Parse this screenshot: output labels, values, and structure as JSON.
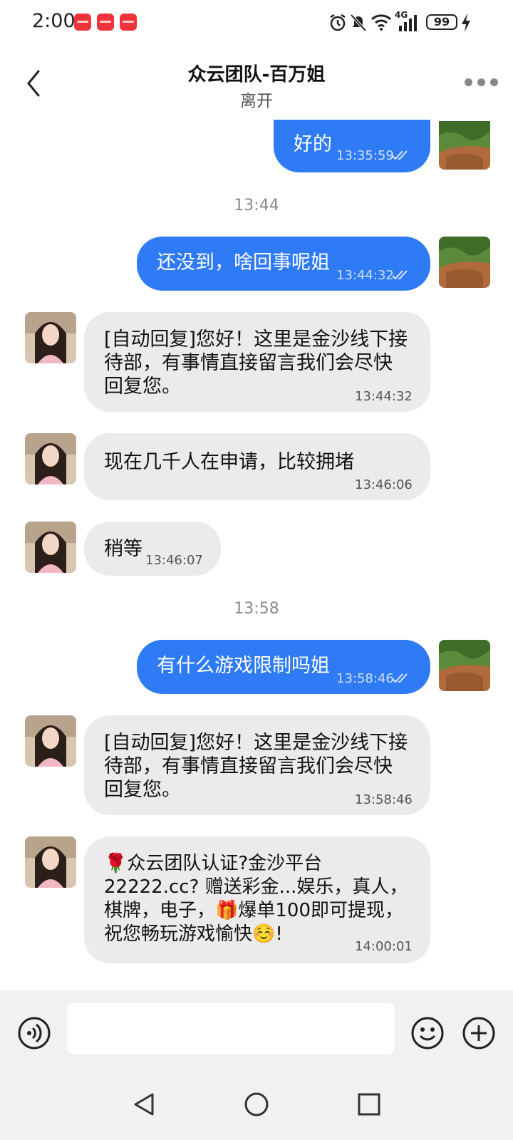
{
  "status_bar": {
    "time": "2:00",
    "battery": "99",
    "network": "4G"
  },
  "header": {
    "title": "众云团队-百万姐",
    "status": "离开"
  },
  "messages": [
    {
      "dir": "out",
      "text": "好的",
      "time": "13:35:59"
    },
    {
      "dir": "divider",
      "time": "13:44"
    },
    {
      "dir": "out",
      "text": "还没到，啥回事呢姐",
      "time": "13:44:32"
    },
    {
      "dir": "in",
      "text": "[自动回复]您好！这里是金沙线下接待部，有事情直接留言我们会尽快回复您。",
      "lines": [
        "[自动回复]您好！这里是金沙线下接",
        "待部，有事情直接留言我们会尽快",
        "回复您。"
      ],
      "time": "13:44:32"
    },
    {
      "dir": "in",
      "text": "现在几千人在申请，比较拥堵",
      "time": "13:46:06"
    },
    {
      "dir": "in",
      "text": "稍等",
      "time": "13:46:07"
    },
    {
      "dir": "divider",
      "time": "13:58"
    },
    {
      "dir": "out",
      "text": "有什么游戏限制吗姐",
      "time": "13:58:46"
    },
    {
      "dir": "in",
      "text": "[自动回复]您好！这里是金沙线下接待部，有事情直接留言我们会尽快回复您。",
      "lines": [
        "[自动回复]您好！这里是金沙线下接",
        "待部，有事情直接留言我们会尽快",
        "回复您。"
      ],
      "time": "13:58:46"
    },
    {
      "dir": "in",
      "text": "🌹众云团队认证?金沙平台22222.cc? 赠送彩金...娱乐，真人，棋牌，电子，🎁爆单100即可提现，祝您畅玩游戏愉快☺️!",
      "lines": [
        "🌹众云团队认证?金沙平台",
        "22222.cc? 赠送彩金...娱乐，真人，",
        "棋牌，电子，🎁爆单100即可提现，",
        "祝您畅玩游戏愉快☺️!"
      ],
      "time": "14:00:01"
    }
  ],
  "input": {
    "placeholder": ""
  },
  "icons": {
    "back": "chevron-left-icon",
    "more": "more-dots-icon",
    "voice": "voice-icon",
    "emoji": "emoji-icon",
    "plus": "plus-icon",
    "nav_back": "triangle-back-icon",
    "nav_home": "circle-home-icon",
    "nav_recent": "square-recent-icon"
  },
  "colors": {
    "outgoing_bubble": "#2f7bf6",
    "incoming_bubble": "#ebebeb",
    "app_badge": "#f0333b"
  }
}
